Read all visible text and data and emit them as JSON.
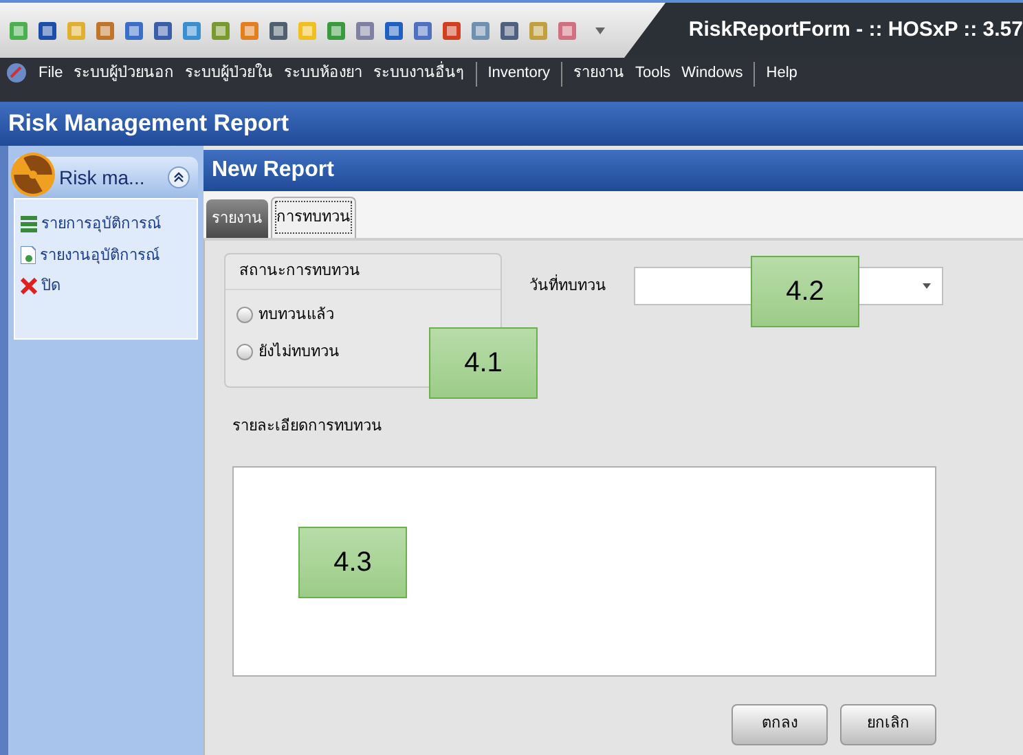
{
  "window": {
    "title": "RiskReportForm - :: HOSxP :: 3.57"
  },
  "menu": [
    {
      "label": "File",
      "kind": "item"
    },
    {
      "label": "ระบบผู้ป่วยนอก",
      "kind": "item"
    },
    {
      "label": "ระบบผู้ป่วยใน",
      "kind": "item"
    },
    {
      "label": "ระบบห้องยา",
      "kind": "item"
    },
    {
      "label": "ระบบงานอื่นๆ",
      "kind": "item"
    },
    {
      "kind": "separator"
    },
    {
      "label": "Inventory",
      "kind": "item"
    },
    {
      "kind": "separator"
    },
    {
      "label": "รายงาน",
      "kind": "item"
    },
    {
      "label": "Tools",
      "kind": "item"
    },
    {
      "label": "Windows",
      "kind": "item"
    },
    {
      "kind": "separator"
    },
    {
      "label": "Help",
      "kind": "item"
    }
  ],
  "header": {
    "title": "Risk Management Report"
  },
  "sidebar": {
    "title": "Risk ma...",
    "items": [
      {
        "label": "รายการอุบัติการณ์",
        "kind": "list"
      },
      {
        "label": "รายงานอุบัติการณ์",
        "kind": "document"
      },
      {
        "label": "ปิด",
        "kind": "close"
      }
    ]
  },
  "panel": {
    "title": "New Report",
    "tabs": [
      {
        "label": "รายงาน",
        "selected": false
      },
      {
        "label": "การทบทวน",
        "selected": true
      }
    ],
    "status_group": {
      "title": "สถานะการทบทวน",
      "options": [
        {
          "label": "ทบทวนแล้ว",
          "selected": false
        },
        {
          "label": "ยังไม่ทบทวน",
          "selected": false
        }
      ]
    },
    "date": {
      "label": "วันที่ทบทวน"
    },
    "details": {
      "label": "รายละเอียดการทบทวน"
    },
    "buttons": [
      "ตกลง",
      "ยกเลิก"
    ]
  },
  "callouts": [
    "4.1",
    "4.2",
    "4.3"
  ]
}
